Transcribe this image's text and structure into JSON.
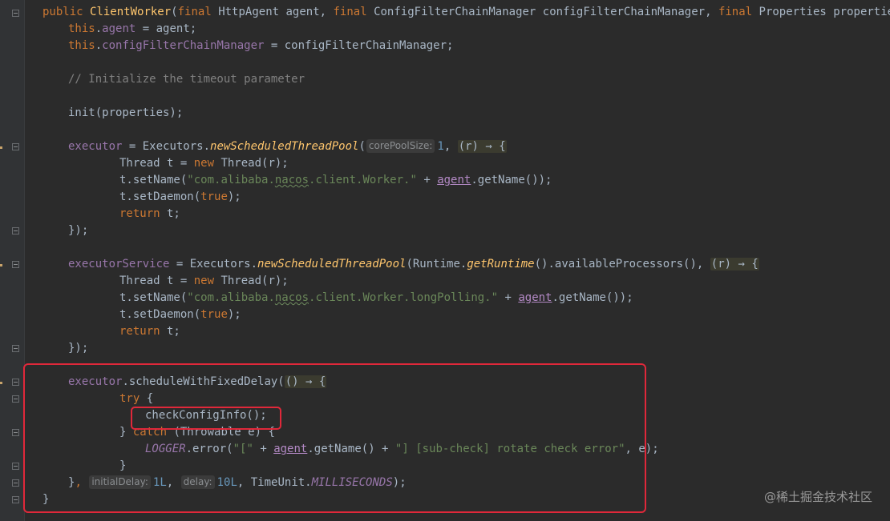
{
  "watermark": "@稀土掘金技术社区",
  "lines": {
    "l1": {
      "kw1": "public",
      "fn": "ClientWorker",
      "p1": "(",
      "kw2": "final",
      "p2": " HttpAgent agent, ",
      "kw3": "final",
      "p3": " ConfigFilterChainManager configFilterChainManager, ",
      "kw4": "final",
      "p4": " Properties properties) {"
    },
    "l2": {
      "kw": "this",
      "dot": ".",
      "fld": "agent",
      "rest": " = agent;"
    },
    "l3": {
      "kw": "this",
      "dot": ".",
      "fld": "configFilterChainManager",
      "rest": " = configFilterChainManager;"
    },
    "l5": {
      "cmt": "// Initialize the timeout parameter"
    },
    "l7": {
      "text": "init(properties);"
    },
    "l9": {
      "fld": "executor",
      "p1": " = Executors.",
      "m": "newScheduledThreadPool",
      "p2": "(",
      "hint": "corePoolSize:",
      "num": "1",
      "p3": ", ",
      "lam": "(r) → {"
    },
    "l10": {
      "p1": "Thread t = ",
      "kw": "new",
      "p2": " Thread(r);"
    },
    "l11": {
      "p1": "t.setName(",
      "str1": "\"com.alibaba.",
      "strw": "nacos",
      "str2": ".client.Worker.\"",
      "p2": " + ",
      "agent": "agent",
      "p3": ".getName());"
    },
    "l12": {
      "p1": "t.setDaemon(",
      "kw": "true",
      "p2": ");"
    },
    "l13": {
      "kw": "return",
      "p": " t;"
    },
    "l14": {
      "text": "});"
    },
    "l16": {
      "fld": "executorService",
      "p1": " = Executors.",
      "m1": "newScheduledThreadPool",
      "p2": "(Runtime.",
      "m2": "getRuntime",
      "p3": "().availableProcessors(), ",
      "lam": "(r) → {"
    },
    "l17": {
      "p1": "Thread t = ",
      "kw": "new",
      "p2": " Thread(r);"
    },
    "l18": {
      "p1": "t.setName(",
      "str1": "\"com.alibaba.",
      "strw": "nacos",
      "str2": ".client.Worker.longPolling.\"",
      "p2": " + ",
      "agent": "agent",
      "p3": ".getName());"
    },
    "l19": {
      "p1": "t.setDaemon(",
      "kw": "true",
      "p2": ");"
    },
    "l20": {
      "kw": "return",
      "p": " t;"
    },
    "l21": {
      "text": "});"
    },
    "l23": {
      "fld": "executor",
      "p1": ".scheduleWithFixedDelay(",
      "lam": "() → {"
    },
    "l24": {
      "kw": "try",
      "p": " {"
    },
    "l25": {
      "text": "checkConfigInfo();"
    },
    "l26": {
      "p1": "} ",
      "kw": "catch",
      "p2": " (Throwable e) {"
    },
    "l27": {
      "const": "LOGGER",
      "p1": ".error(",
      "str1": "\"[\"",
      "p2": " + ",
      "agent": "agent",
      "p3": ".getName() + ",
      "str2": "\"] [sub-check] rotate check error\"",
      "p4": ", e);"
    },
    "l28": {
      "text": "}"
    },
    "l29": {
      "p1": "}",
      "kw": ",",
      "hint1": "initialDelay:",
      "num1": "1L",
      "p2": ", ",
      "hint2": "delay:",
      "num2": "10L",
      "p3": ", TimeUnit.",
      "const": "MILLISECONDS",
      "p4": ");"
    },
    "l30": {
      "text": "}"
    }
  }
}
